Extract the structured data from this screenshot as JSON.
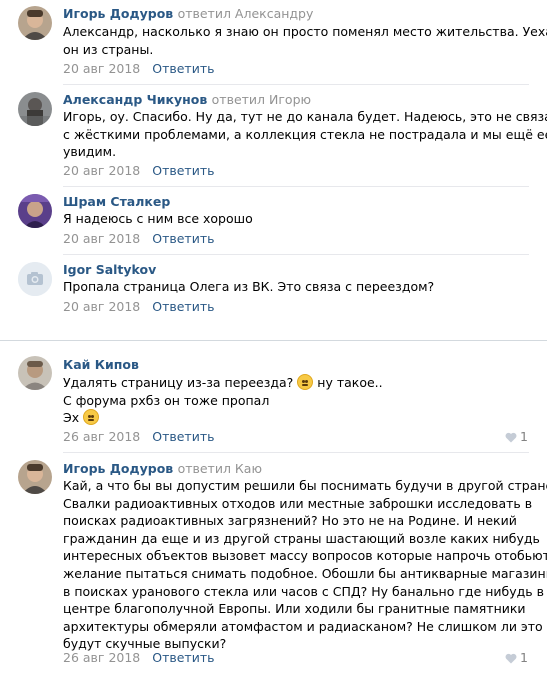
{
  "thread1": {
    "comments": [
      {
        "author": "Игорь Додуров",
        "reply_to": "ответил Александру",
        "lines": [
          "Александр, насколько я знаю он просто поменял место жительства. Уехал",
          "он из страны."
        ],
        "date": "20 авг 2018",
        "reply_label": "Ответить",
        "avatar": "avatar-photo-man"
      },
      {
        "author": "Александр Чикунов",
        "reply_to": "ответил Игорю",
        "lines": [
          "Игорь, оу. Спасибо. Ну да, тут не до канала будет. Надеюсь, это не связано",
          "с жёсткими проблемами, а коллекция стекла не пострадала и мы ещё ее",
          "увидим."
        ],
        "date": "20 авг 2018",
        "reply_label": "Ответить",
        "avatar": "avatar-photo-man"
      },
      {
        "author": "Шрам Сталкер",
        "reply_to": "",
        "lines": [
          "Я надеюсь с ним все хорошо"
        ],
        "date": "20 авг 2018",
        "reply_label": "Ответить",
        "avatar": "avatar-photo-purple"
      },
      {
        "author": "Igor Saltykov",
        "reply_to": "",
        "lines": [
          "Пропала страница Олега из ВК. Это связа с переездом?"
        ],
        "date": "20 авг 2018",
        "reply_label": "Ответить",
        "avatar": "camera-icon"
      }
    ]
  },
  "thread2": {
    "comments": [
      {
        "author": "Кай Кипов",
        "reply_to": "",
        "lines": [
          "Удалять страницу из-за переезда?",
          "ну такое..",
          "С форума рхбз он тоже пропал",
          "Эх"
        ],
        "date": "26 авг 2018",
        "reply_label": "Ответить",
        "likes": "1",
        "avatar": "avatar-photo-man"
      },
      {
        "author": "Игорь Додуров",
        "reply_to": "ответил Каю",
        "lines": [
          "Кай, а что бы вы допустим решили бы поснимать будучи в другой стране?",
          "Свалки радиоактивных отходов или местные заброшки исследовать в",
          "поисках радиоактивных загрязнений? Но это не на Родине. И некий",
          "гражданин да еще и из другой страны шастающий возле каких нибудь",
          "интересных объектов вызовет массу вопросов которые напрочь отобьют",
          "желание пытаться снимать подобное. Обошли бы антикварные магазины",
          "в поисках уранового стекла или часов с СПД? Ну банально где нибудь в",
          "центре благополучной Европы. Или ходили бы гранитные памятники",
          "архитектуры обмеряли атомфастом и радиасканом? Не слишком ли это",
          "будут скучные выпуски?"
        ],
        "date": "26 авг 2018",
        "reply_label": "Ответить",
        "likes": "1",
        "avatar": "avatar-photo-man"
      }
    ]
  },
  "colors": {
    "author": "#2a5885",
    "meta": "#939393",
    "divider": "#e7e8ec"
  }
}
